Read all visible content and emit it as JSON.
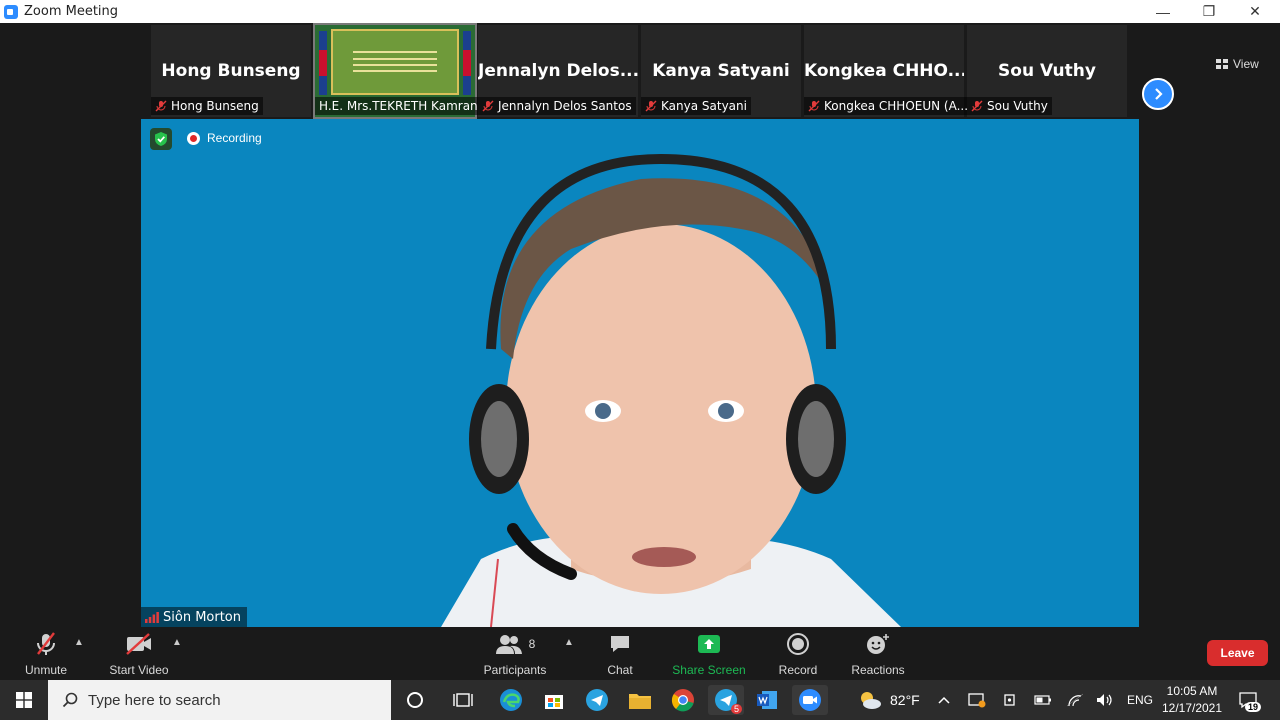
{
  "window": {
    "title": "Zoom Meeting"
  },
  "gallery": {
    "view_label": "View",
    "tiles": [
      {
        "big_name": "Hong Bunseng",
        "tag": "Hong Bunseng"
      },
      {
        "big_name": "",
        "tag": "H.E. Mrs.TEKRETH Kamran..."
      },
      {
        "big_name": "Jennalyn  Delos...",
        "tag": "Jennalyn Delos Santos"
      },
      {
        "big_name": "Kanya Satyani",
        "tag": "Kanya Satyani"
      },
      {
        "big_name": "Kongkea  CHHO...",
        "tag": "Kongkea CHHOEUN (A..."
      },
      {
        "big_name": "Sou Vuthy",
        "tag": "Sou Vuthy"
      }
    ]
  },
  "main": {
    "recording_label": "Recording",
    "speaker_name": "Siôn Morton"
  },
  "toolbar": {
    "unmute": "Unmute",
    "start_video": "Start Video",
    "participants": "Participants",
    "participants_count": "8",
    "chat": "Chat",
    "share_screen": "Share Screen",
    "record": "Record",
    "reactions": "Reactions",
    "leave": "Leave"
  },
  "taskbar": {
    "search_placeholder": "Type here to search",
    "telegram_badge": "5",
    "weather_temp": "82°F",
    "language": "ENG",
    "time": "10:05 AM",
    "date": "12/17/2021",
    "notifications": "19"
  },
  "colors": {
    "zoom_blue": "#2d8cff",
    "leave_red": "#d92d2d",
    "share_green": "#1db954",
    "video_bg": "#0a86bf"
  }
}
